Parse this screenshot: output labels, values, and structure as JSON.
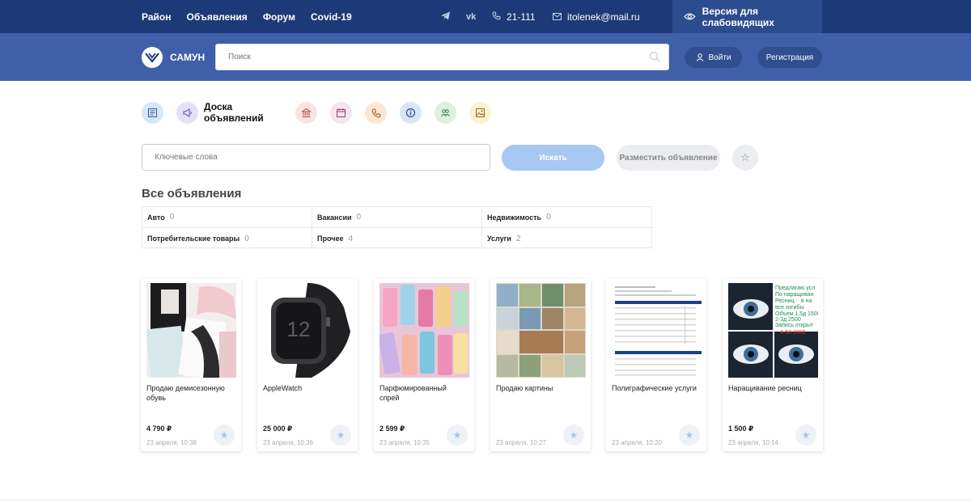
{
  "topbar": {
    "nav": [
      "Район",
      "Объявления",
      "Форум",
      "Covid-19"
    ],
    "phone": "21-111",
    "email": "itolenek@mail.ru",
    "vision_label": "Версия для слабовидящих"
  },
  "header": {
    "logo_text": "САМУН",
    "search_placeholder": "Поиск",
    "login_label": "Войти",
    "register_label": "Регистрация"
  },
  "board": {
    "title_line1": "Доска",
    "title_line2": "объявлений",
    "keywords_placeholder": "Ключевые слова",
    "search_button": "Искать",
    "place_button": "Разместить объявление"
  },
  "categories": {
    "title": "Все объявления",
    "items": [
      {
        "name": "Авто",
        "count": "0"
      },
      {
        "name": "Вакансии",
        "count": "0"
      },
      {
        "name": "Недвижимость",
        "count": "0"
      },
      {
        "name": "Потребительские товары",
        "count": "0"
      },
      {
        "name": "Прочее",
        "count": "4"
      },
      {
        "name": "Услуги",
        "count": "2"
      }
    ]
  },
  "ads": [
    {
      "title": "Продаю демисезонную обувь",
      "price": "4 790 ₽",
      "date": "23 апреля, 10:38"
    },
    {
      "title": "AppleWatch",
      "price": "25 000 ₽",
      "date": "23 апреля, 10:36"
    },
    {
      "title": "Парфюмированный спрей",
      "price": "2 599 ₽",
      "date": "23 апреля, 10:35"
    },
    {
      "title": "Продаю картины",
      "price": "",
      "date": "23 апреля, 10:27"
    },
    {
      "title": "Полиграфические услуги",
      "price": "",
      "date": "23 апреля, 10:20"
    },
    {
      "title": "Наращивание ресниц",
      "price": "1 500 ₽",
      "date": "23 апреля, 10:14"
    }
  ],
  "eyelash_image_text": [
    "Предлагаю усл",
    "По наращиван",
    "Ресниц",
    "в на",
    "все изгибы",
    "Объем 1,5д 1500",
    "2-3д 2500",
    "Запись открыт",
    "4-50 2800"
  ],
  "colors": {
    "topbar": "#1c3a78",
    "header": "#3f5fa8",
    "accent_light": "#a6c8f2"
  }
}
